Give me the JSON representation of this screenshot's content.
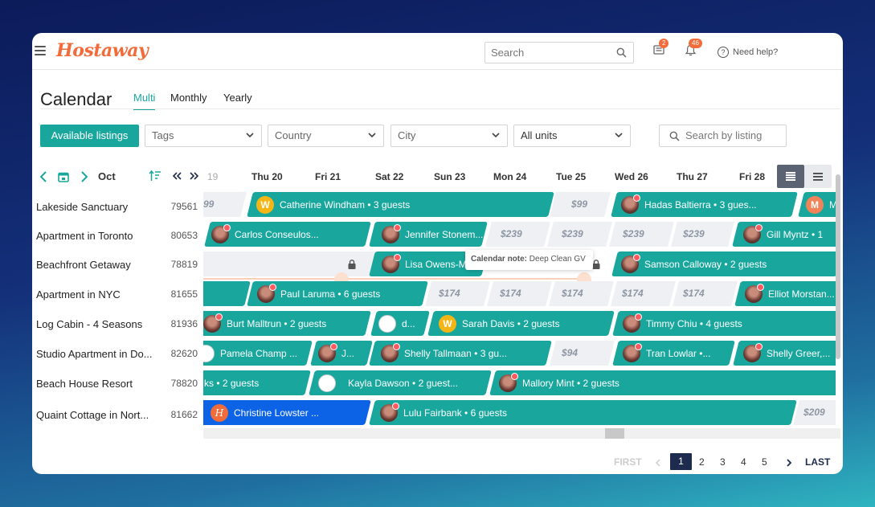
{
  "app": {
    "logo": "Hostaway"
  },
  "header": {
    "search_placeholder": "Search",
    "messages_count": "2",
    "notifications_count": "46",
    "help_label": "Need help?"
  },
  "page": {
    "title": "Calendar",
    "tabs": [
      {
        "label": "Multi"
      },
      {
        "label": "Monthly"
      },
      {
        "label": "Yearly"
      }
    ]
  },
  "filters": {
    "available_listings": "Available listings",
    "tags": "Tags",
    "country": "Country",
    "city": "City",
    "units": "All units",
    "search_listing_placeholder": "Search by listing"
  },
  "calendar": {
    "month": "Oct",
    "dates": [
      "19",
      "Thu 20",
      "Fri 21",
      "Sat 22",
      "Sun 23",
      "Mon 24",
      "Tue 25",
      "Wed 26",
      "Thu 27",
      "Fri 28"
    ],
    "listings": [
      {
        "name": "Lakeside Sanctuary",
        "id": "79561"
      },
      {
        "name": "Apartment in Toronto",
        "id": "80653"
      },
      {
        "name": "Beachfront Getaway",
        "id": "78819"
      },
      {
        "name": "Apartment in NYC",
        "id": "81655"
      },
      {
        "name": "Log Cabin - 4 Seasons",
        "id": "81936"
      },
      {
        "name": "Studio Apartment in Do...",
        "id": "82620"
      },
      {
        "name": "Beach House Resort",
        "id": "78820"
      },
      {
        "name": "Quaint Cottage in Nort...",
        "id": "81662"
      }
    ],
    "rows": [
      {
        "prices": [
          "99",
          "$99"
        ],
        "bookings": [
          "Catherine Windham • 3 guests",
          "Hadas Baltierra • 3 gues...",
          "M"
        ]
      },
      {
        "prices": [
          "$239",
          "$239",
          "$239",
          "$239"
        ],
        "bookings": [
          "Carlos Conseulos...",
          "Jennifer Stonem...",
          "Gill Myntz • 1"
        ]
      },
      {
        "prices": [],
        "bookings": [
          "Lisa Owens-M",
          "Samson Calloway • 2 guests"
        ]
      },
      {
        "prices": [
          "$174",
          "$174",
          "$174",
          "$174",
          "$174"
        ],
        "bookings": [
          "Paul Laruma • 6 guests",
          "Elliot Morstan..."
        ]
      },
      {
        "prices": [],
        "bookings": [
          "Burt Malltrun • 2 guests",
          "d...",
          "Sarah Davis • 2 guests",
          "Timmy Chiu • 4 guests"
        ]
      },
      {
        "prices": [
          "$94"
        ],
        "bookings": [
          "Pamela Champ ...",
          "J...",
          "Shelly Tallmaan • 3 gu...",
          "Tran Lowlar •...",
          "Shelly Greer,..."
        ]
      },
      {
        "prices": [],
        "bookings": [
          "ks • 2 guests",
          "Kayla Dawson • 2 guest...",
          "Mallory Mint • 2 guests"
        ]
      },
      {
        "prices": [
          "$209"
        ],
        "bookings": [
          "Christine Lowster ...",
          "Lulu Fairbank • 6 guests"
        ]
      }
    ],
    "tooltip": {
      "label": "Calendar note:",
      "text": "Deep Clean GV"
    }
  },
  "pagination": {
    "first": "FIRST",
    "pages": [
      "1",
      "2",
      "3",
      "4",
      "5"
    ],
    "last": "LAST"
  },
  "colors": {
    "teal": "#19a79d",
    "orange": "#f26b3a",
    "blue": "#0d63e6",
    "navy": "#1d2b4f"
  }
}
